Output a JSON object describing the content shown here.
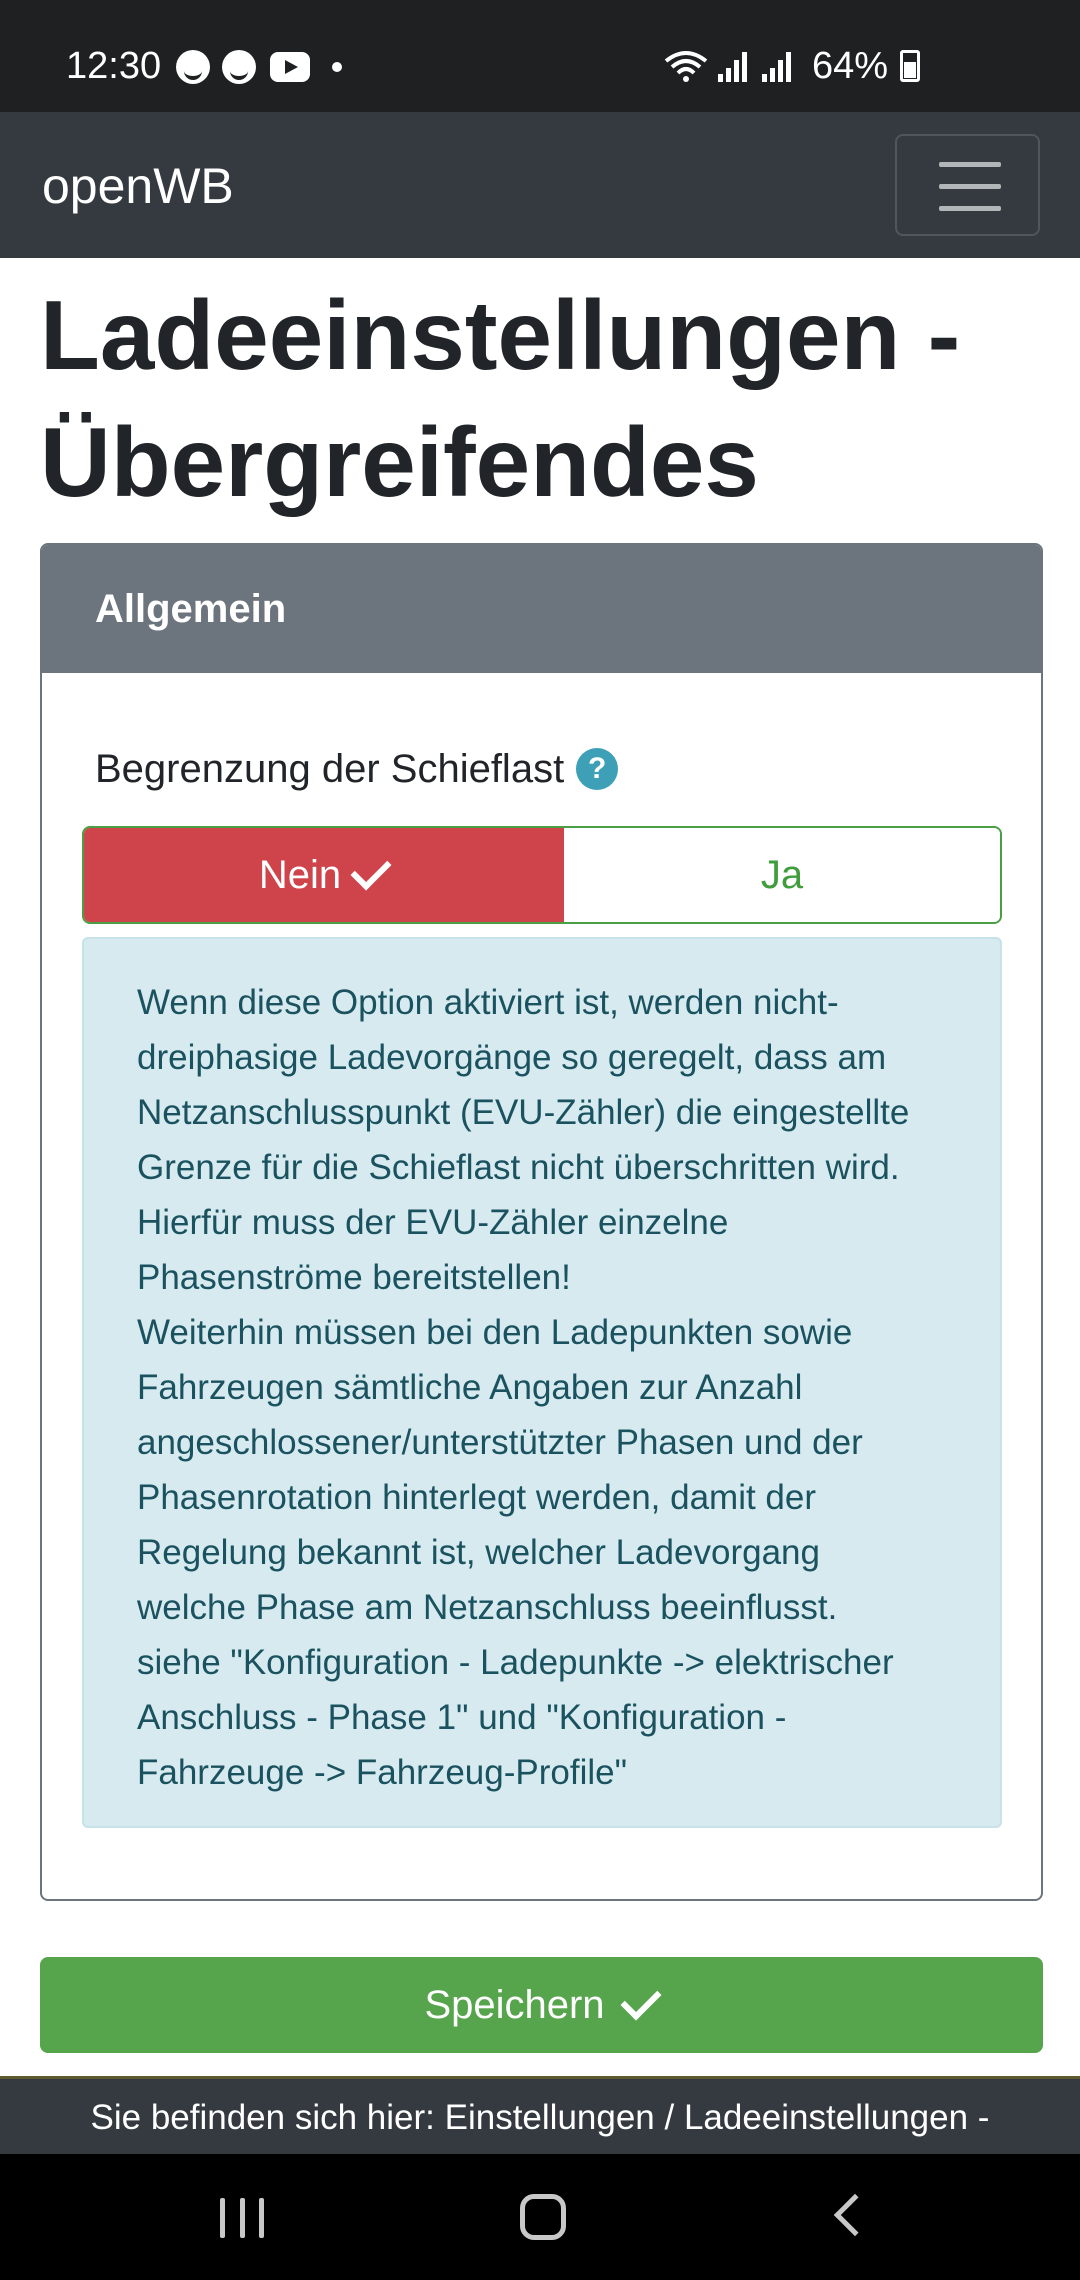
{
  "status_bar": {
    "time": "12:30",
    "battery": "64%",
    "left_icons": [
      "notification-app-icon",
      "notification-app-icon",
      "youtube-icon",
      "dot-icon"
    ],
    "right_icons": [
      "wifi-icon",
      "signal-icon",
      "signal-icon",
      "battery-icon"
    ]
  },
  "navbar": {
    "brand": "openWB",
    "menu_icon": "hamburger-menu-icon"
  },
  "page": {
    "title_line1": "Ladeeinstellungen -",
    "title_line2": "Übergreifendes"
  },
  "card": {
    "header": "Allgemein",
    "field_label": "Begrenzung der Schieflast",
    "help_symbol": "?",
    "options": {
      "nein": "Nein",
      "ja": "Ja",
      "selected": "nein"
    },
    "info_lines": [
      "Wenn diese Option aktiviert ist, werden nicht-",
      "dreiphasige Ladevorgänge so geregelt, dass am",
      "Netzanschlusspunkt (EVU-Zähler) die eingestellte",
      "Grenze für die Schieflast nicht überschritten wird.",
      "Hierfür muss der EVU-Zähler einzelne",
      "Phasenströme bereitstellen!",
      "Weiterhin müssen bei den Ladepunkten sowie",
      "Fahrzeugen sämtliche Angaben zur Anzahl",
      "angeschlossener/unterstützter Phasen und der",
      "Phasenrotation hinterlegt werden, damit der",
      "Regelung bekannt ist, welcher Ladevorgang",
      "welche Phase am Netzanschluss beeinflusst.",
      "siehe \"Konfiguration - Ladepunkte -> elektrischer",
      "Anschluss - Phase 1\" und \"Konfiguration -",
      "Fahrzeuge -> Fahrzeug-Profile\""
    ]
  },
  "save_button": {
    "label": "Speichern"
  },
  "footer": {
    "breadcrumb": "Sie befinden sich hier: Einstellungen / Ladeeinstellungen -"
  },
  "colors": {
    "navbar": "#343a40",
    "card_header": "#6c757d",
    "danger": "#cf434a",
    "success": "#56a44c",
    "info_bg": "#d6eaef",
    "info_text": "#1b5260",
    "help": "#3da0b7"
  }
}
